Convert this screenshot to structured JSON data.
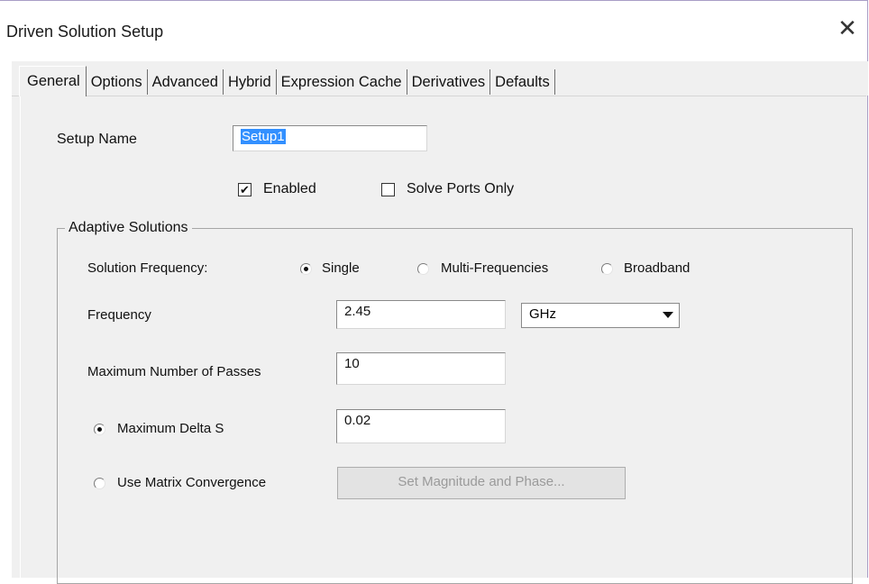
{
  "window": {
    "title": "Driven Solution Setup"
  },
  "tabs": [
    "General",
    "Options",
    "Advanced",
    "Hybrid",
    "Expression Cache",
    "Derivatives",
    "Defaults"
  ],
  "setup": {
    "name_label": "Setup Name",
    "name_value": "Setup1",
    "enabled_label": "Enabled",
    "enabled_checked": true,
    "solve_ports_label": "Solve Ports Only",
    "solve_ports_checked": false
  },
  "adaptive": {
    "group_label": "Adaptive Solutions",
    "solution_frequency_label": "Solution Frequency:",
    "freq_options": [
      "Single",
      "Multi-Frequencies",
      "Broadband"
    ],
    "freq_selected": "Single",
    "frequency_label": "Frequency",
    "frequency_value": "2.45",
    "frequency_unit": "GHz",
    "max_passes_label": "Maximum Number of Passes",
    "max_passes_value": "10",
    "max_delta_s_label": "Maximum Delta S",
    "max_delta_s_value": "0.02",
    "matrix_conv_label": "Use Matrix Convergence",
    "set_mag_phase_button": "Set Magnitude and Phase..."
  }
}
